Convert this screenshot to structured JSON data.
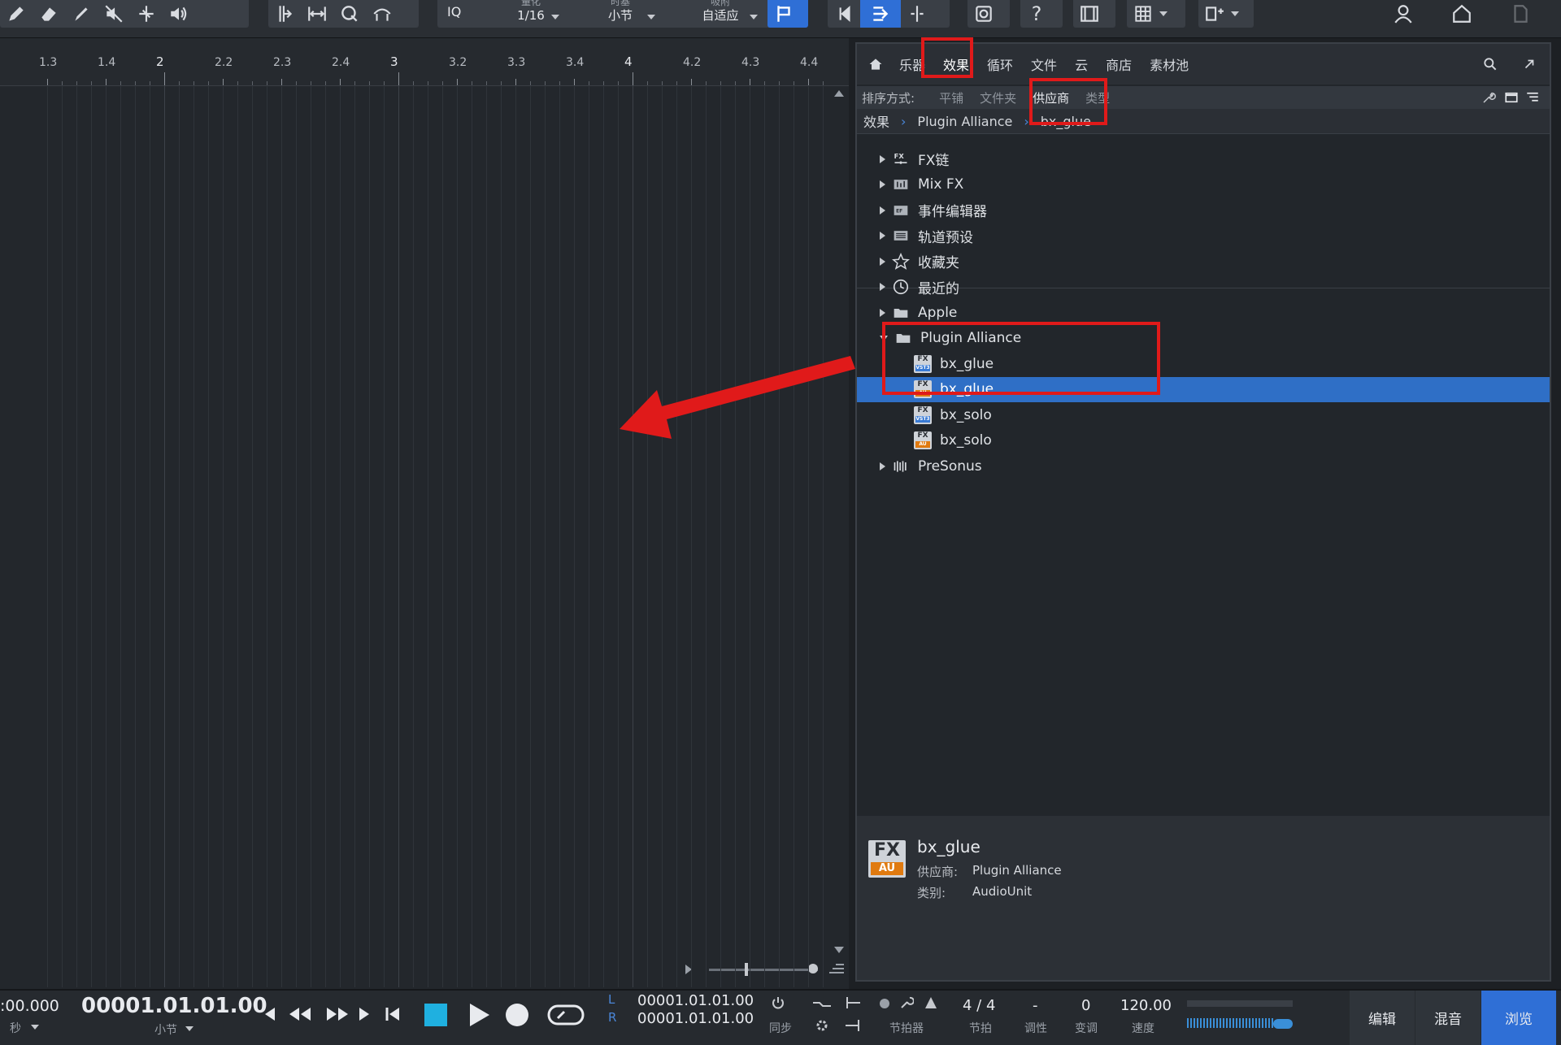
{
  "toolbar": {
    "iq_label": "IQ",
    "quantize": {
      "label": "量化",
      "value": "1/16"
    },
    "timebase": {
      "label": "时基",
      "value": "小节"
    },
    "snap": {
      "label": "吸附",
      "value": "自适应"
    }
  },
  "ruler": {
    "labels": [
      "1.3",
      "1.4",
      "2",
      "2.2",
      "2.3",
      "2.4",
      "3",
      "3.2",
      "3.3",
      "3.4",
      "4",
      "4.2",
      "4.3",
      "4.4"
    ],
    "major": [
      "2",
      "3",
      "4"
    ]
  },
  "browser": {
    "tabs": [
      "乐器",
      "效果",
      "循环",
      "文件",
      "云",
      "商店",
      "素材池"
    ],
    "active_tab": "效果",
    "sort_label": "排序方式:",
    "sort_options": [
      "平铺",
      "文件夹",
      "供应商",
      "类型"
    ],
    "active_sort": "供应商",
    "breadcrumb": [
      "效果",
      "Plugin Alliance",
      "bx_glue"
    ],
    "tree": [
      {
        "label": "FX链",
        "icon": "fx-chain-icon",
        "level": 0,
        "expandable": true
      },
      {
        "label": "Mix FX",
        "icon": "mix-fx-icon",
        "level": 0,
        "expandable": true
      },
      {
        "label": "事件编辑器",
        "icon": "event-editor-icon",
        "level": 0,
        "expandable": true
      },
      {
        "label": "轨道预设",
        "icon": "track-preset-icon",
        "level": 0,
        "expandable": true
      },
      {
        "label": "收藏夹",
        "icon": "star-icon",
        "level": 0,
        "expandable": true
      },
      {
        "label": "最近的",
        "icon": "clock-icon",
        "level": 0,
        "expandable": true
      },
      {
        "label": "Apple",
        "icon": "folder-icon",
        "level": 0,
        "expandable": true
      },
      {
        "label": "Plugin Alliance",
        "icon": "folder-icon",
        "level": 0,
        "expandable": true,
        "expanded": true
      },
      {
        "label": "bx_glue",
        "icon": "fx-plugin-icon",
        "format": "VST3",
        "level": 1
      },
      {
        "label": "bx_glue",
        "icon": "fx-plugin-icon",
        "format": "AU",
        "level": 1,
        "selected": true
      },
      {
        "label": "bx_solo",
        "icon": "fx-plugin-icon",
        "format": "VST3",
        "level": 1
      },
      {
        "label": "bx_solo",
        "icon": "fx-plugin-icon",
        "format": "AU",
        "level": 1
      },
      {
        "label": "PreSonus",
        "icon": "presonus-icon",
        "level": 0,
        "expandable": true
      }
    ],
    "info": {
      "badge_top": "FX",
      "badge_bottom": "AU",
      "name": "bx_glue",
      "vendor_label": "供应商:",
      "vendor": "Plugin Alliance",
      "type_label": "类别:",
      "type": "AudioUnit"
    }
  },
  "transport": {
    "time_seconds": ":00.000",
    "time_seconds_unit": "秒",
    "position": "00001.01.01.00",
    "position_unit": "小节",
    "loop_left": "00001.01.01.00",
    "loop_right": "00001.01.01.00",
    "L": "L",
    "R": "R",
    "sync_label": "同步",
    "metronome_label": "节拍器",
    "signature": "4 / 4",
    "signature_label": "节拍",
    "key": "-",
    "key_label": "调性",
    "transpose": "0",
    "transpose_label": "变调",
    "tempo": "120.00",
    "tempo_label": "速度",
    "nav": [
      "编辑",
      "混音",
      "浏览"
    ],
    "active_nav": "浏览"
  },
  "colors": {
    "accent": "#2f6fd6",
    "annotation_red": "#e01a1a",
    "au_orange": "#e07a10",
    "vst_blue": "#3a7bd5"
  }
}
